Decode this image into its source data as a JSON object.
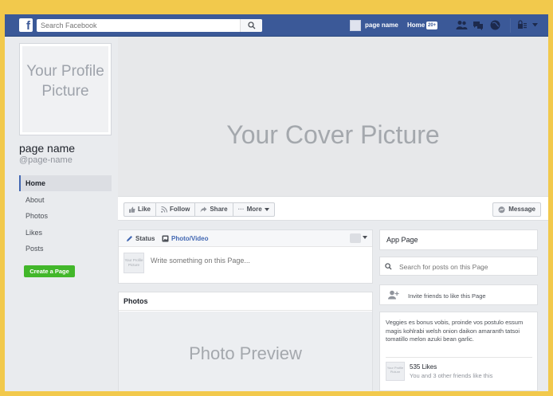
{
  "topbar": {
    "logo": "f",
    "search_placeholder": "Search Facebook",
    "page_name": "page name",
    "home_label": "Home",
    "home_badge": "20+"
  },
  "profile": {
    "picture_text": "Your Profile Picture",
    "name": "page name",
    "handle": "@page-name"
  },
  "side_nav": [
    "Home",
    "About",
    "Photos",
    "Likes",
    "Posts"
  ],
  "create_page_label": "Create a Page",
  "cover": {
    "text": "Your Cover Picture"
  },
  "actions": {
    "like": "Like",
    "follow": "Follow",
    "share": "Share",
    "more": "More",
    "message": "Message"
  },
  "composer": {
    "status_tab": "Status",
    "photo_tab": "Photo/Video",
    "placeholder": "Write something on this Page...",
    "avatar_text": "Your Profile Picture"
  },
  "photos": {
    "title": "Photos",
    "preview_text": "Photo Preview"
  },
  "right": {
    "app_page": "App Page",
    "search_placeholder": "Search for posts on this Page",
    "invite": "Invite friends to like this Page",
    "about": "Veggies es bonus vobis, proinde vos postulo essum magis kohlrabi welsh onion daikon amaranth tatsoi tomatillo melon azuki bean garlic.",
    "likes_count": "535 Likes",
    "likes_friends": "You and 3 other friends like this",
    "avatar_text": "Your Profile Picture"
  },
  "colors": {
    "background": "#f2c94c",
    "brand": "#3b5998",
    "create_button": "#42b72a"
  }
}
